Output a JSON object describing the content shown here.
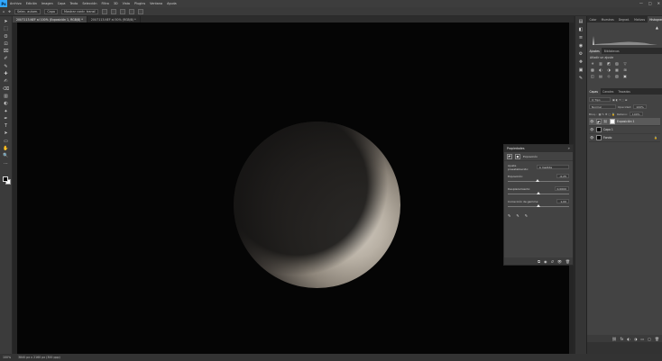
{
  "app": {
    "logo": "Ps"
  },
  "menu": [
    "Archivo",
    "Edición",
    "Imagen",
    "Capa",
    "Texto",
    "Selección",
    "Filtro",
    "3D",
    "Vista",
    "Plugins",
    "Ventana",
    "Ayuda"
  ],
  "window_controls": [
    "—",
    "□",
    "✕"
  ],
  "options_bar": {
    "home": "⌂",
    "tool": "✥",
    "field1": "Selec. autom.",
    "field2": "Capa",
    "show_controls": "Mostrar contr. transf."
  },
  "tabs": [
    {
      "label": "20U7113.NEF al 100% (Exposición 1, RGB/8) *",
      "active": true
    },
    {
      "label": "20U7113.NEF al 50% (RGB/8) *",
      "active": false
    }
  ],
  "tools": [
    "➤",
    "⬚",
    "ʘ",
    "⊡",
    "⌧",
    "✐",
    "✎",
    "✚",
    "✍",
    "⌫",
    "▥",
    "◐",
    "✦",
    "✒",
    "T",
    "➤",
    "▭",
    "✋",
    "🔍",
    "⋯"
  ],
  "right_strip": [
    "▤",
    "◧",
    "≡",
    "◉",
    "⚙",
    "❖",
    "▣",
    "✎"
  ],
  "panels": {
    "histogram_tabs": [
      "Color",
      "Muestras",
      "Degrad.",
      "Motivos",
      "Histograma"
    ],
    "histogram_warning": "▲",
    "adjustments_tabs": [
      "Ajustes",
      "Bibliotecas"
    ],
    "adjustments_label": "Añadir un ajuste",
    "adjustment_icons": [
      "☀",
      "▥",
      "◩",
      "▨",
      "▽",
      "▩",
      "◐",
      "◑",
      "▦",
      "⊞",
      "◫",
      "▤",
      "◇",
      "▧",
      "▣"
    ],
    "layers_tabs": [
      "Capas",
      "Canales",
      "Trazados"
    ],
    "layers_filter": "Q Tipo",
    "blend_mode": "Normal",
    "opacity_label": "Opacidad:",
    "opacity_value": "100%",
    "lock_label": "Bloq.:",
    "fill_label": "Relleno:",
    "fill_value": "100%",
    "layers": [
      {
        "name": "Exposición 1",
        "type": "adjustment",
        "selected": true
      },
      {
        "name": "Capa 1",
        "type": "image",
        "selected": false
      },
      {
        "name": "Fondo",
        "type": "background",
        "selected": false
      }
    ],
    "layers_footer": [
      "⛓",
      "fx",
      "◐",
      "◑",
      "▭",
      "▢",
      "🗑"
    ]
  },
  "properties": {
    "title": "Propiedades",
    "header_label": "Exposición",
    "preset_label": "Ajuste preestablecido:",
    "preset_value": "A medida",
    "exposure_label": "Exposición:",
    "exposure_value": "-0,25",
    "exposure_fraction": 0.49,
    "offset_label": "Desplazamiento:",
    "offset_value": "0,0000",
    "offset_fraction": 0.5,
    "gamma_label": "Corrección de gamma:",
    "gamma_value": "1,00",
    "gamma_fraction": 0.5,
    "droppers": [
      "✎",
      "✎",
      "✎"
    ],
    "footer": [
      "⧉",
      "◉",
      "↺",
      "👁",
      "🗑"
    ]
  },
  "status": {
    "zoom": "100%",
    "doc": "3840 px x 2160 px (300 ppp)"
  }
}
